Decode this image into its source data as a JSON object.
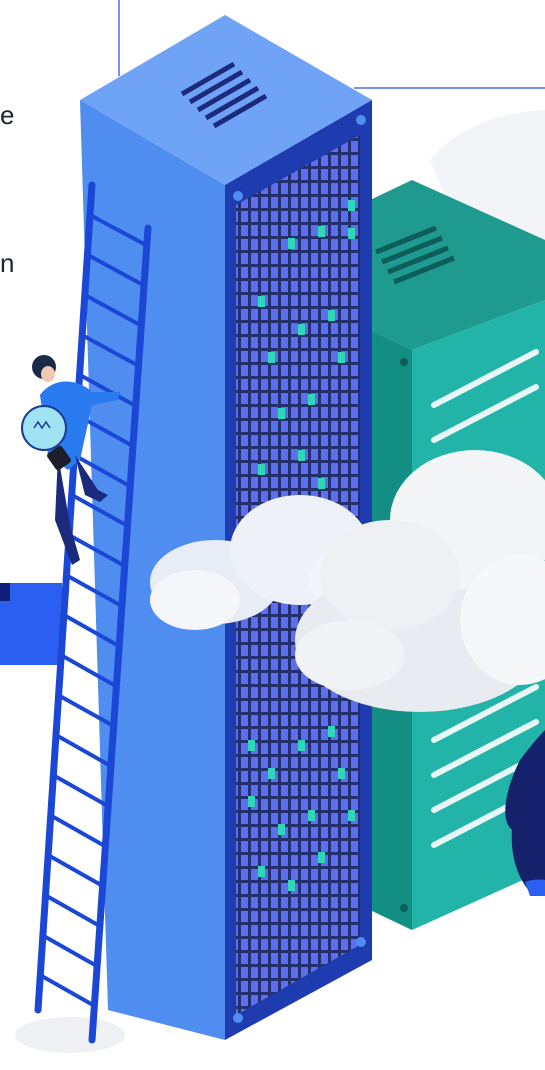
{
  "text_fragments": {
    "line1": "e",
    "line2": "n"
  },
  "illustration": {
    "name": "server-racks-ladder-illustration",
    "colors": {
      "blue_rack_front": "#4f8ef0",
      "blue_rack_side": "#1f3bb0",
      "blue_rack_top": "#6ea3f6",
      "blue_led": "#5b6ff0",
      "green_led": "#2fd6b8",
      "teal_rack_front": "#22b4a8",
      "teal_rack_side": "#128e85",
      "teal_rack_top": "#1f9a8f",
      "ladder": "#1b47d6",
      "cloud": "#f1f4f8",
      "guide_line": "#4f6fe8",
      "cta_block": "#2a5ff2"
    }
  }
}
